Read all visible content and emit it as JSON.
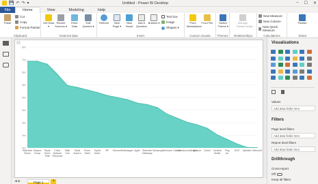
{
  "window": {
    "title": "Untitled - Power BI Desktop",
    "controls": [
      "–",
      "☐",
      "✕"
    ]
  },
  "menu": {
    "file": "File",
    "tabs": [
      "Home",
      "View",
      "Modeling",
      "Help"
    ]
  },
  "ribbon": {
    "clipboard": {
      "paste": "Paste",
      "cut": "Cut",
      "copy": "Copy",
      "format_painter": "Format Painter",
      "label": "Clipboard"
    },
    "external": {
      "get_data": "Get Data ▾",
      "recent_sources": "Recent Sources ▾",
      "enter_data": "Enter Data",
      "edit_queries": "Edit Queries ▾",
      "label": "External data"
    },
    "insert": {
      "refresh": "Refresh",
      "new_page": "New Page ▾",
      "new_visual": "New Visual",
      "ask_question": "Ask A Question",
      "buttons": "Buttons ▾",
      "text_box": "Text box",
      "image": "Image",
      "shapes": "Shapes ▾",
      "label": "Insert"
    },
    "custom": {
      "from_marketplace": "From Marketplace",
      "from_file": "From File",
      "label": "Custom visuals"
    },
    "themes": {
      "switch_theme": "Switch Theme ▾",
      "label": "Themes"
    },
    "relationships": {
      "manage": "Manage Relationships",
      "label": "Relationships"
    },
    "calculations": {
      "new_measure": "New Measure",
      "new_column": "New Column",
      "new_quick_measure": "New Quick Measure",
      "label": "Calculations"
    },
    "share": {
      "publish": "Publish",
      "label": "Share"
    }
  },
  "chart_data": {
    "type": "area",
    "color": "#5fd0c2",
    "ylim": [
      0,
      1000
    ],
    "y_ticks": [
      "0bn",
      "1bn",
      "2bn",
      "3bn",
      "4bn",
      "5bn",
      "6bn",
      "7bn",
      "8bn"
    ],
    "categories": [
      "Wall-Mart Stores",
      "Sinopec Group",
      "Royal Dutch Shell",
      "China National Petroleum",
      "State Grid",
      "Saudi Aramco",
      "Exxon Mobil",
      "Toyota Motor",
      "BP",
      "Glencore",
      "Volkswagen",
      "Apple",
      "Berkshire Hathaway",
      "Samsung",
      "McKesson",
      "Daimler",
      "AmerisourceBergen",
      "Amazon",
      "Costco",
      "Cardinal Health",
      "Ping An",
      "AT&T",
      "Alphabet",
      "Microsoft"
    ],
    "values": [
      860,
      860,
      830,
      730,
      620,
      600,
      575,
      550,
      520,
      500,
      480,
      445,
      430,
      400,
      335,
      295,
      255,
      230,
      195,
      130,
      85,
      40,
      5,
      2
    ]
  },
  "page_tabs": {
    "nav": "◀ ▶",
    "pages": [
      "Page 1"
    ],
    "add": "+"
  },
  "right_pane": {
    "visualizations": "Visualizations",
    "values_label": "Values",
    "values_placeholder": "Add data fields here",
    "filters_title": "Filters",
    "page_filters": "Page level filters",
    "page_placeholder": "Add data fields here",
    "report_filters": "Report level filters",
    "report_placeholder": "Add data fields here",
    "drillthrough": "Drillthrough",
    "cross_report": "Cross-report",
    "off_label": "Off",
    "keep_filters": "Keep all filters"
  }
}
